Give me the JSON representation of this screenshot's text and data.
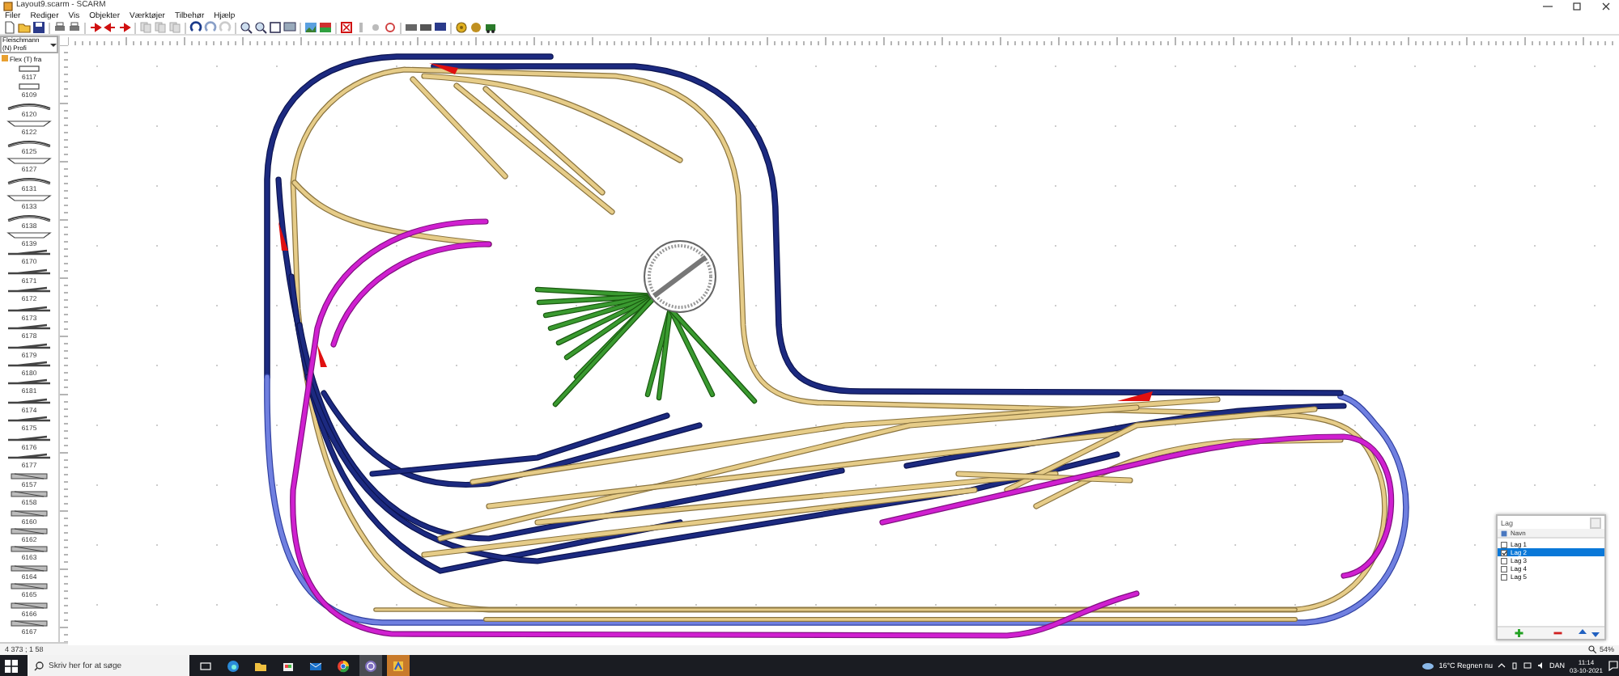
{
  "window": {
    "title": "Layout9.scarm - SCARM"
  },
  "menu": [
    {
      "label": "Filer"
    },
    {
      "label": "Rediger"
    },
    {
      "label": "Vis"
    },
    {
      "label": "Objekter"
    },
    {
      "label": "Værktøjer"
    },
    {
      "label": "Tilbehør"
    },
    {
      "label": "Hjælp"
    }
  ],
  "library": {
    "selector": "Fleischmann (N) Profi",
    "category": "Flex (T) fra",
    "parts": [
      {
        "label": "6117"
      },
      {
        "label": "6109"
      },
      {
        "label": "6120"
      },
      {
        "label": "6122"
      },
      {
        "label": "6125"
      },
      {
        "label": "6127"
      },
      {
        "label": "6131"
      },
      {
        "label": "6133"
      },
      {
        "label": "6138"
      },
      {
        "label": "6139"
      },
      {
        "label": "6170"
      },
      {
        "label": "6171"
      },
      {
        "label": "6172"
      },
      {
        "label": "6173"
      },
      {
        "label": "6178"
      },
      {
        "label": "6179"
      },
      {
        "label": "6180"
      },
      {
        "label": "6181"
      },
      {
        "label": "6174"
      },
      {
        "label": "6175"
      },
      {
        "label": "6176"
      },
      {
        "label": "6177"
      },
      {
        "label": "6157"
      },
      {
        "label": "6158"
      },
      {
        "label": "6160"
      },
      {
        "label": "6162"
      },
      {
        "label": "6163"
      },
      {
        "label": "6164"
      },
      {
        "label": "6165"
      },
      {
        "label": "6166"
      },
      {
        "label": "6167"
      }
    ]
  },
  "layers_panel": {
    "title": "Lag",
    "header": "Navn",
    "layers": [
      {
        "name": "Lag 1",
        "checked": false,
        "selected": false
      },
      {
        "name": "Lag 2",
        "checked": true,
        "selected": true
      },
      {
        "name": "Lag 3",
        "checked": false,
        "selected": false
      },
      {
        "name": "Lag 4",
        "checked": false,
        "selected": false
      },
      {
        "name": "Lag 5",
        "checked": false,
        "selected": false
      }
    ]
  },
  "status_bar": {
    "coordinates": "4 373 ; 1 58",
    "zoom": "54%"
  },
  "taskbar": {
    "search_placeholder": "Skriv her for at søge",
    "weather": "16°C Regnen nu",
    "language": "DAN",
    "time": "11:14",
    "date": "03-10-2021"
  }
}
